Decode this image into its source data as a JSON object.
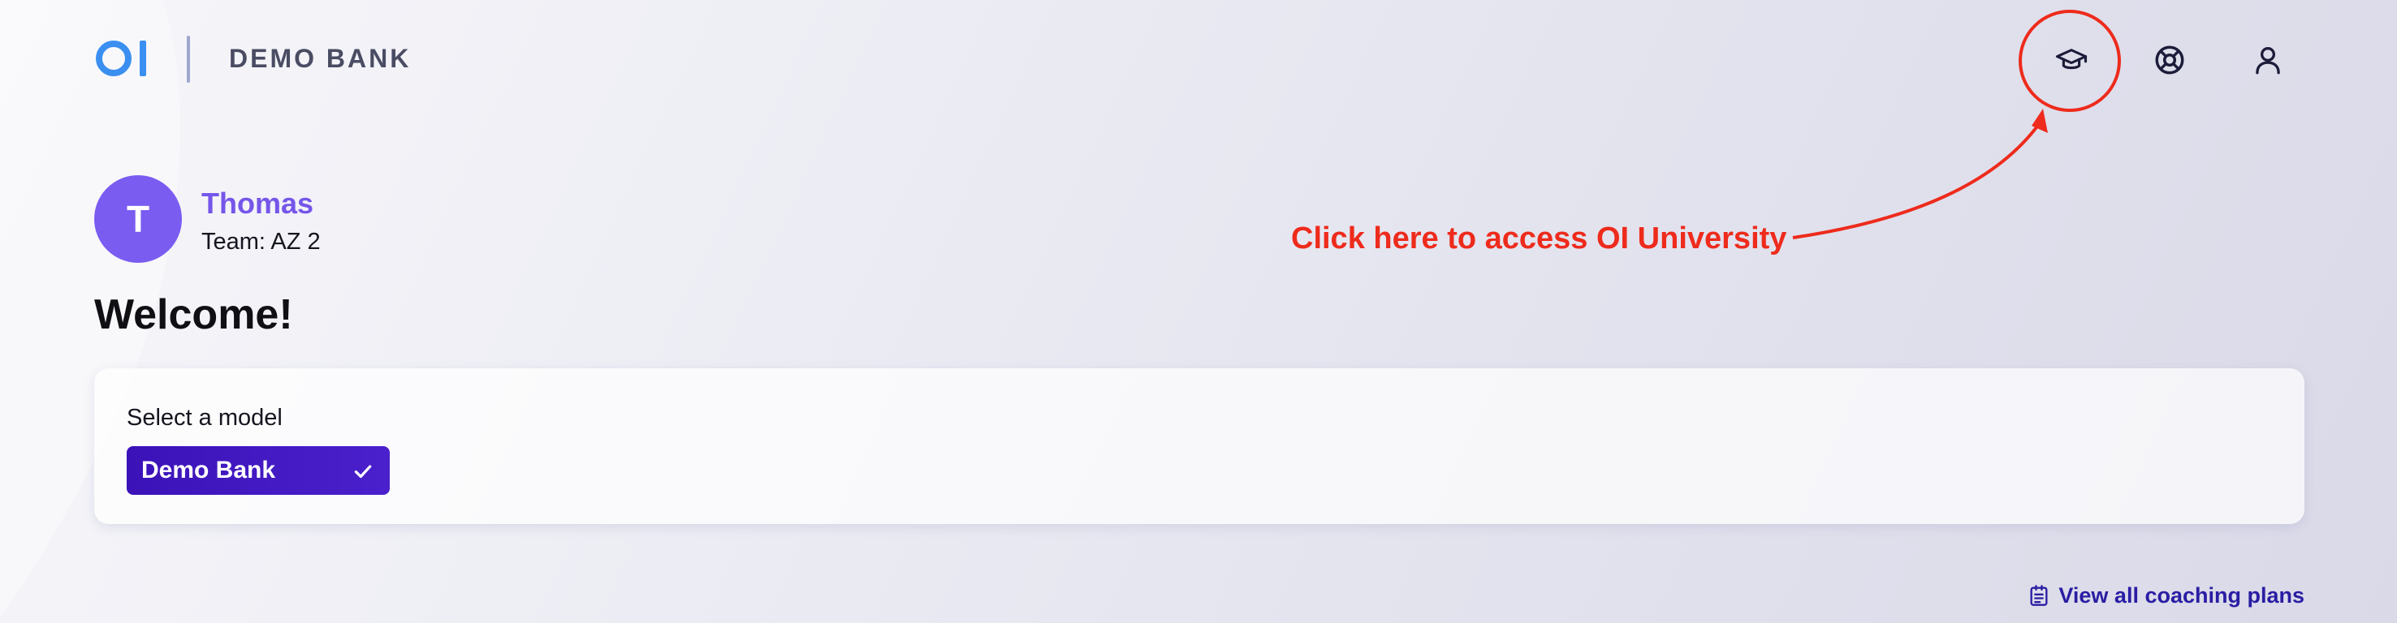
{
  "header": {
    "logo_text": "OI",
    "brand_name": "DEMO BANK",
    "icons": [
      "graduation-cap-icon",
      "help-lifebuoy-icon",
      "user-profile-icon"
    ]
  },
  "annotation": {
    "text": "Click here to access OI University",
    "color": "#ee2b1c"
  },
  "user": {
    "initial": "T",
    "name": "Thomas",
    "team": "Team: AZ 2"
  },
  "welcome": "Welcome!",
  "model_selector": {
    "label": "Select a model",
    "selected": "Demo Bank"
  },
  "coaching_link": {
    "label": "View all coaching plans"
  },
  "colors": {
    "accent_purple": "#7b5cf0",
    "button_indigo": "#3b12b8",
    "link_indigo": "#2a1da3",
    "logo_blue": "#3b8ff0",
    "annotation_red": "#ee2b1c"
  }
}
